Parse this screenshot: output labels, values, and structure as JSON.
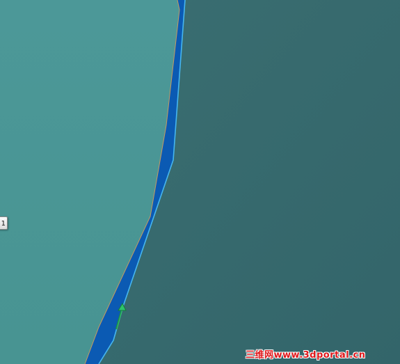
{
  "colors": {
    "background": "#38686b",
    "face_left": "#4b9797",
    "face_right": "#386a6d",
    "selected_edge_fill": "#0b5ab3",
    "selected_edge_highlight": "#46b6f0",
    "face_border": "#c59a62",
    "handle_arrow": "#2ec46a",
    "watermark": "#e0181b"
  },
  "icons": {
    "direction_handle": "drag-arrow-icon"
  },
  "callout": {
    "label": "1"
  },
  "watermark": {
    "text": "三维网www.3dportal.cn"
  }
}
